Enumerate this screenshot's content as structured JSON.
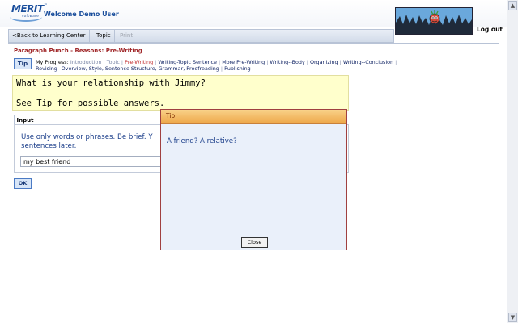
{
  "header": {
    "logo_text": "MERIT",
    "logo_sub": "software",
    "welcome": "Welcome Demo User",
    "logout": "Log out"
  },
  "nav": {
    "back": "<Back to Learning Center",
    "topic": "Topic",
    "print": "Print"
  },
  "page": {
    "title": "Paragraph Punch - Reasons: Pre-Writing",
    "tip_button": "Tip"
  },
  "progress": {
    "label": "My Progress:",
    "steps": [
      {
        "label": "Introduction",
        "state": "done"
      },
      {
        "label": "Topic",
        "state": "done"
      },
      {
        "label": "Pre-Writing",
        "state": "current"
      },
      {
        "label": "Writing-Topic Sentence",
        "state": "todo"
      },
      {
        "label": "More Pre-Writing",
        "state": "todo"
      },
      {
        "label": "Writing--Body",
        "state": "todo"
      },
      {
        "label": "Organizing",
        "state": "todo"
      },
      {
        "label": "Writing--Conclusion",
        "state": "todo"
      },
      {
        "label": "Revising--Overview, Style, Sentence Structure, Grammar, Proofreading",
        "state": "todo"
      },
      {
        "label": "Publishing",
        "state": "todo"
      }
    ]
  },
  "prompt": {
    "line1": "What is your relationship with Jimmy?",
    "line2": "See Tip for possible answers."
  },
  "input_panel": {
    "tab": "Input",
    "hint": "Use only words or phrases. Be brief. Y... sentences later.",
    "hint_line1": "Use only words or phrases. Be brief. Y",
    "hint_line2": "sentences later.",
    "value": "my best friend"
  },
  "ok_button": "OK",
  "tip_dialog": {
    "title": "Tip",
    "text": "A friend? A relative?",
    "close": "Close"
  },
  "colors": {
    "brand_blue": "#1a4e9c",
    "title_red": "#a0282a",
    "prompt_bg": "#ffffcc",
    "dialog_title": "#eea94c"
  }
}
